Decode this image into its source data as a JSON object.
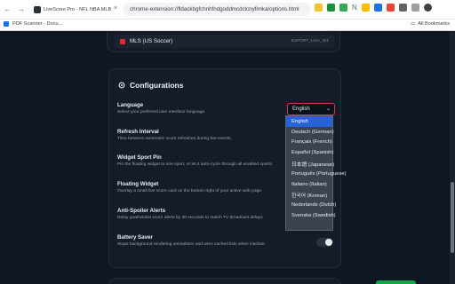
{
  "browser": {
    "tab_title": "LiveScore Pro - NFL NBA MLB NHL Alerts",
    "url": "chrome-extension://fldackbgfchnhfndgoddmcdclcnyfimka/options.html",
    "bookmark_1": "PDF Scanner - Docu...",
    "bookmarks_right": "All Bookmarks",
    "ext_text": "N"
  },
  "mls": {
    "label": "MLS (US Soccer)",
    "id": "ESPORT_USA_ID1"
  },
  "config": {
    "title": "Configurations",
    "settings": [
      {
        "title": "Language",
        "desc": "Select your preferred user interface language."
      },
      {
        "title": "Refresh Interval",
        "desc": "Time between automatic score refreshes during live events."
      },
      {
        "title": "Widget Sport Pin",
        "desc": "Pin the floating widget to one sport, or let it auto-cycle through all enabled sports."
      },
      {
        "title": "Floating Widget",
        "desc": "Overlay a small live score card on the bottom-right of your active web page."
      },
      {
        "title": "Anti-Spoiler Alerts",
        "desc": "Delay goal/wicket score alerts by 30 seconds to match TV broadcast delays."
      },
      {
        "title": "Battery Saver",
        "desc": "Stops background rendering animations and uses cached lists when inactive."
      }
    ],
    "language_selected": "English",
    "language_options": [
      "English",
      "Deutsch (German)",
      "Français (French)",
      "Español (Spanish)",
      "日本語 (Japanese)",
      "Português (Portuguese)",
      "Italiano (Italian)",
      "한국어 (Korean)",
      "Nederlands (Dutch)",
      "Svenska (Swedish)"
    ]
  },
  "colors": {
    "accent": "#d2394a",
    "selected": "#2463d9",
    "bg": "#0f1722"
  }
}
